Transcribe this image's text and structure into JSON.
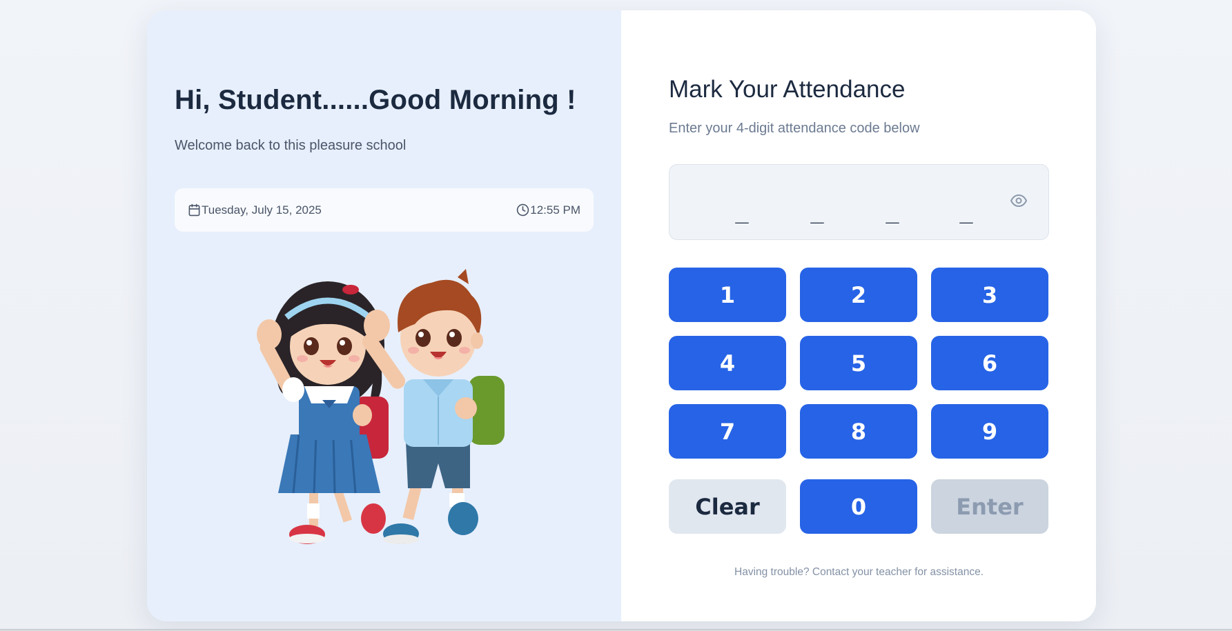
{
  "greeting": {
    "title": "Hi, Student......Good Morning !",
    "subtitle": "Welcome back to this pleasure school"
  },
  "info": {
    "date": "Tuesday, July 15, 2025",
    "time": "12:55 PM",
    "date_icon": "calendar-icon",
    "time_icon": "clock-icon"
  },
  "illustration": {
    "name": "two-students-waving-illustration"
  },
  "attendance": {
    "title": "Mark Your Attendance",
    "hint": "Enter your 4-digit attendance code below",
    "slots": [
      "_",
      "_",
      "_",
      "_"
    ],
    "toggle_icon": "eye-icon"
  },
  "keypad": {
    "keys": [
      "1",
      "2",
      "3",
      "4",
      "5",
      "6",
      "7",
      "8",
      "9"
    ],
    "clear_label": "Clear",
    "zero_label": "0",
    "enter_label": "Enter"
  },
  "footer": {
    "text": "Having trouble? Contact your teacher for assistance."
  },
  "colors": {
    "primary": "#2663e6",
    "heading": "#1c2a40",
    "left_panel": "#e7effc",
    "disabled": "#cbd4df"
  }
}
